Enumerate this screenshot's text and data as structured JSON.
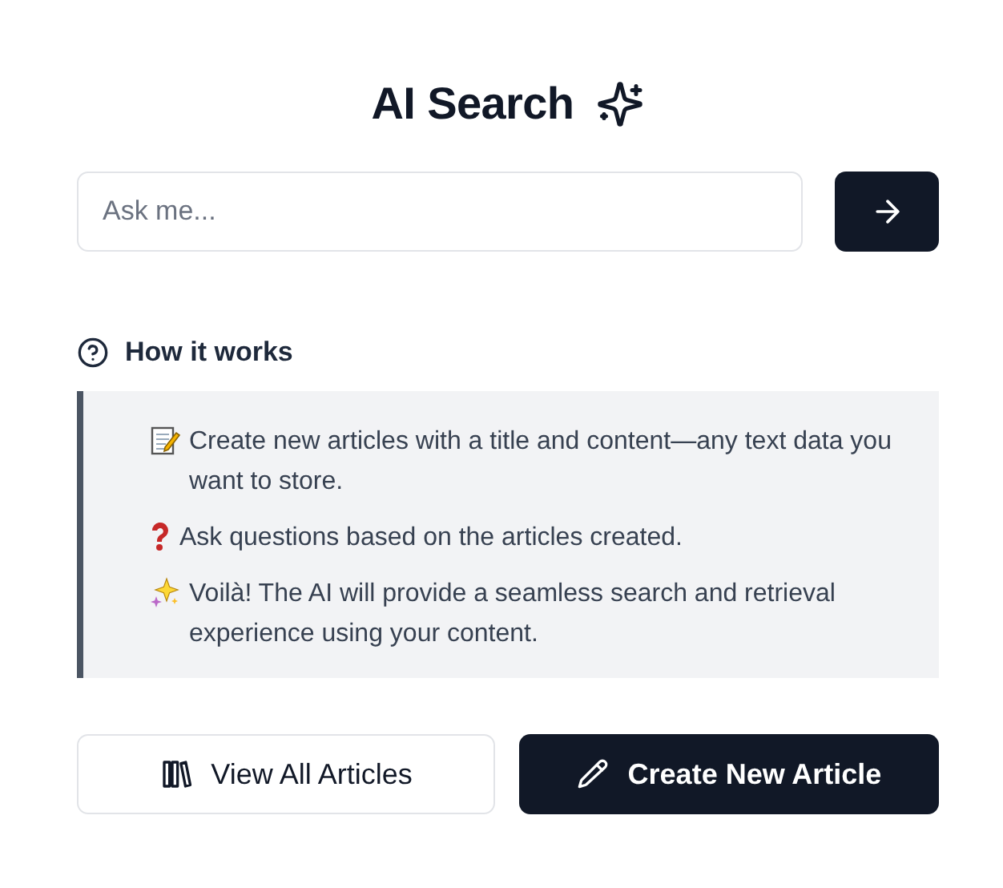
{
  "title": "AI Search",
  "search": {
    "placeholder": "Ask me..."
  },
  "how_it_works": {
    "heading": "How it works",
    "steps": [
      {
        "kind": "memo",
        "text": "Create new articles with a title and content—any text data you want to store."
      },
      {
        "kind": "question",
        "text": "Ask questions based on the articles created."
      },
      {
        "kind": "sparkles",
        "text": "Voilà! The AI will provide a seamless search and retrieval experience using your content."
      }
    ]
  },
  "buttons": [
    {
      "kind": "secondary",
      "label": "View All Articles"
    },
    {
      "kind": "primary",
      "label": "Create New Article"
    }
  ]
}
